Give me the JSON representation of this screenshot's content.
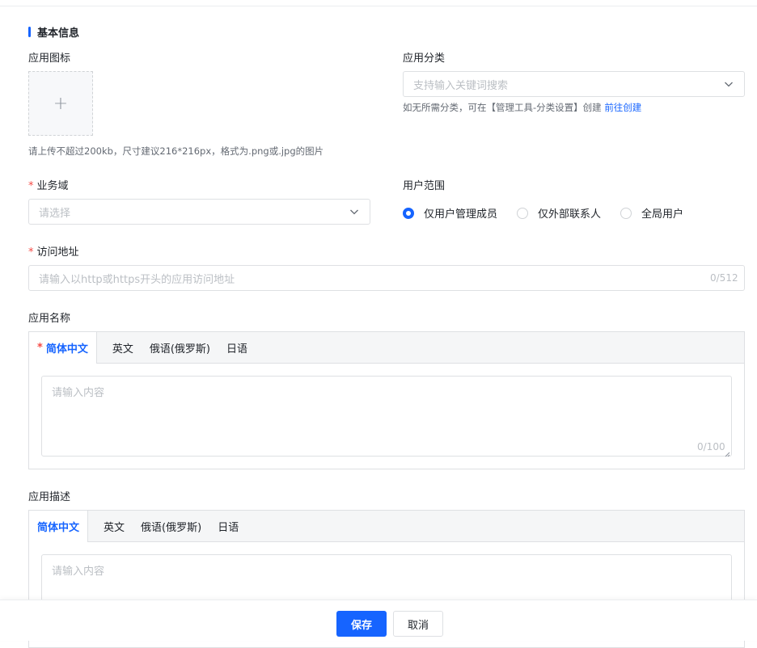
{
  "basic_info": {
    "title": "基本信息",
    "icon_label": "应用图标",
    "upload_plus": "+",
    "upload_hint": "请上传不超过200kb，尺寸建议216*216px，格式为.png或.jpg的图片",
    "category_label": "应用分类",
    "category_placeholder": "支持输入关键词搜索",
    "category_hint": "如无所需分类，可在【管理工具-分类设置】创建",
    "category_link": "前往创建"
  },
  "business_domain": {
    "required": "*",
    "label": "业务域",
    "placeholder": "请选择"
  },
  "user_scope": {
    "label": "用户范围",
    "options": [
      "仅用户管理成员",
      "仅外部联系人",
      "全局用户"
    ],
    "selected": "仅用户管理成员"
  },
  "access_url": {
    "required": "*",
    "label": "访问地址",
    "placeholder": "请输入以http或https开头的应用访问地址",
    "counter": "0/512"
  },
  "app_name": {
    "label": "应用名称",
    "tabs": [
      "简体中文",
      "英文",
      "俄语(俄罗斯)",
      "日语"
    ],
    "active_tab_required": "*",
    "placeholder": "请输入内容",
    "counter": "0/100"
  },
  "app_desc": {
    "label": "应用描述",
    "tabs": [
      "简体中文",
      "英文",
      "俄语(俄罗斯)",
      "日语"
    ],
    "placeholder": "请输入内容"
  },
  "footer": {
    "save_label": "保存",
    "cancel_label": "取消"
  },
  "colors": {
    "accent": "#1664ff",
    "required": "#f54a45"
  }
}
